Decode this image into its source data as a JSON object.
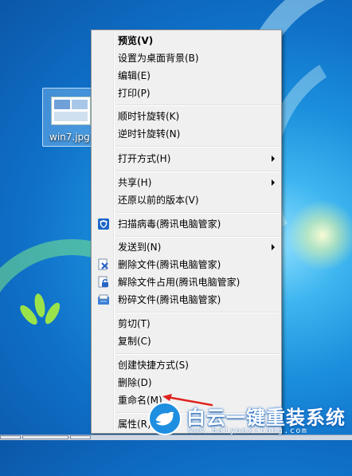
{
  "desktop_icon": {
    "label": "win7.jpg"
  },
  "menu": {
    "items": [
      {
        "label": "预览(V)",
        "bold": true
      },
      {
        "label": "设置为桌面背景(B)"
      },
      {
        "label": "编辑(E)"
      },
      {
        "label": "打印(P)"
      },
      {
        "label": "顺时针旋转(K)"
      },
      {
        "label": "逆时针旋转(N)"
      },
      {
        "label": "打开方式(H)",
        "submenu": true
      },
      {
        "label": "共享(H)",
        "submenu": true
      },
      {
        "label": "还原以前的版本(V)"
      },
      {
        "label": "扫描病毒(腾讯电脑管家)",
        "icon": "shield-icon"
      },
      {
        "label": "发送到(N)",
        "submenu": true
      },
      {
        "label": "删除文件(腾讯电脑管家)",
        "icon": "delete-file-icon"
      },
      {
        "label": "解除文件占用(腾讯电脑管家)",
        "icon": "unlock-file-icon"
      },
      {
        "label": "粉碎文件(腾讯电脑管家)",
        "icon": "shred-file-icon"
      },
      {
        "label": "剪切(T)"
      },
      {
        "label": "复制(C)"
      },
      {
        "label": "创建快捷方式(S)"
      },
      {
        "label": "删除(D)"
      },
      {
        "label": "重命名(M)"
      },
      {
        "label": "属性(R)"
      }
    ]
  },
  "watermark": {
    "title": "白云一键重装系统",
    "url": "www.baiyunxitong.com"
  },
  "colors": {
    "menu_bg": "#f0f0f0",
    "accent_arrow": "#e0231e",
    "brand_blue": "#1e8fe0"
  }
}
